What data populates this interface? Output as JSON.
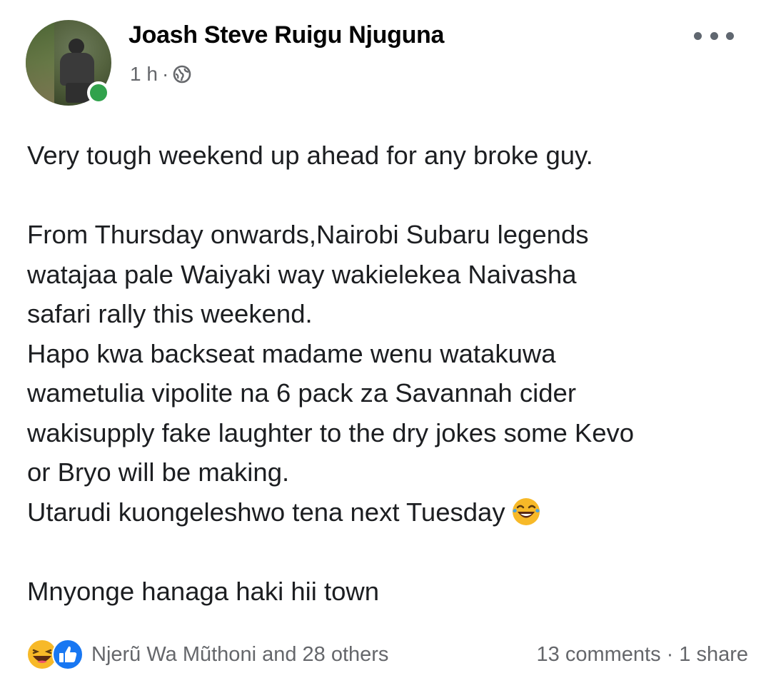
{
  "post": {
    "author": "Joash Steve Ruigu Njuguna",
    "time": "1 h",
    "meta_separator": "·",
    "privacy_icon": "globe-icon",
    "more_icon": "more-options-icon",
    "paragraphs": [
      "Very tough weekend up ahead for any broke guy.",
      "",
      "From Thursday onwards,Nairobi Subaru legends",
      "watajaa pale Waiyaki way wakielekea Naivasha",
      "safari rally this weekend.",
      "Hapo kwa backseat madame wenu watakuwa",
      "wametulia vipolite na 6 pack za Savannah cider",
      "wakisupply fake laughter to the dry jokes some Kevo",
      "or Bryo will be making.",
      "Utarudi kuongeleshwo tena next Tuesday",
      "",
      "Mnyonge hanaga haki hii town"
    ],
    "inline_emoji": "laughing-tears-emoji"
  },
  "footer": {
    "reaction_icons": [
      "haha-reaction-icon",
      "like-reaction-icon"
    ],
    "reacted_by": "Njerũ Wa Mũthoni and 28 others",
    "comments": "13 comments",
    "separator": "·",
    "shares": "1 share"
  },
  "colors": {
    "text": "#1c1e21",
    "secondary_text": "#65676b",
    "online": "#31a24c",
    "like_blue": "#1877f2",
    "haha_yellow": "#f7b928"
  }
}
